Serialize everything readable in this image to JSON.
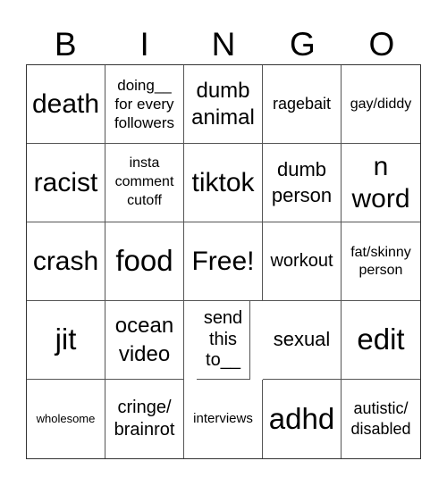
{
  "header": [
    "B",
    "I",
    "N",
    "G",
    "O"
  ],
  "cells": [
    "death",
    "doing__ for every followers",
    "dumb animal",
    "ragebait",
    "gay/diddy",
    "racist",
    "insta comment cutoff",
    "tiktok",
    "dumb person",
    "n word",
    "crash",
    "food",
    "Free!",
    "workout",
    "fat/skinny person",
    "jit",
    "ocean video",
    "send this to__",
    "sexual",
    "edit",
    "wholesome",
    "cringe/ brainrot",
    "interviews",
    "adhd",
    "autistic/ disabled"
  ]
}
